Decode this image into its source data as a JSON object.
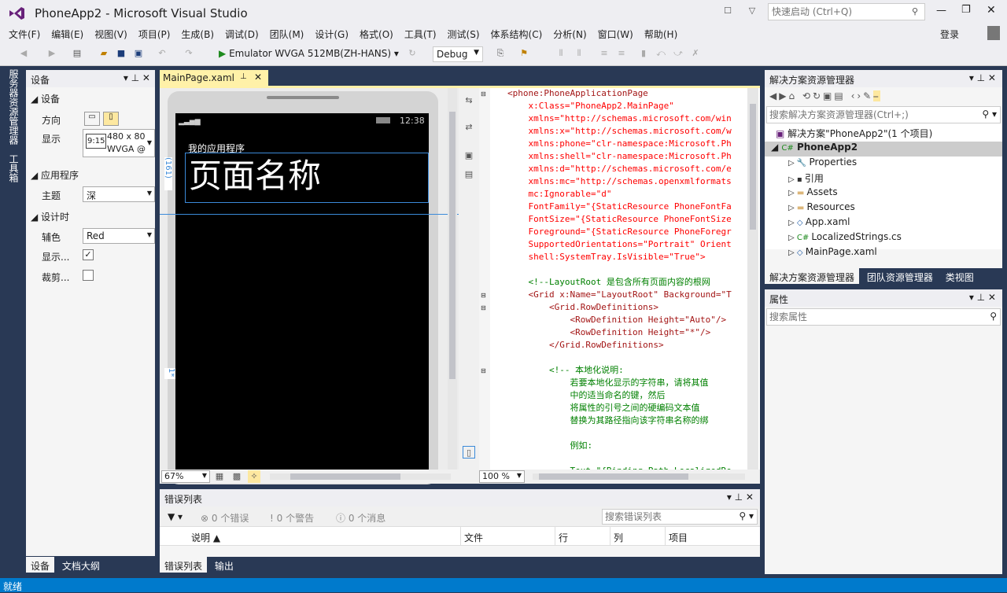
{
  "app": {
    "title": "PhoneApp2 - Microsoft Visual Studio",
    "quick_launch_placeholder": "快速启动 (Ctrl+Q)",
    "signin": "登录"
  },
  "menu": [
    "文件(F)",
    "编辑(E)",
    "视图(V)",
    "项目(P)",
    "生成(B)",
    "调试(D)",
    "团队(M)",
    "设计(G)",
    "格式(O)",
    "工具(T)",
    "测试(S)",
    "体系结构(C)",
    "分析(N)",
    "窗口(W)",
    "帮助(H)"
  ],
  "toolbar": {
    "run_target": "Emulator WVGA 512MB(ZH-HANS)",
    "config": "Debug"
  },
  "left_side_tabs": [
    "服务器资源管理器",
    "工具箱"
  ],
  "device_panel": {
    "title": "设备",
    "section_device": "设备",
    "orientation_label": "方向",
    "display_label": "显示",
    "display_value": "480 x 80",
    "display_value2": "WVGA @",
    "display_icon": "9:15",
    "section_app": "应用程序",
    "theme_label": "主题",
    "theme_value": "深",
    "section_design": "设计时",
    "accent_label": "辅色",
    "accent_value": "Red",
    "show_label": "显示...",
    "clip_label": "裁剪...",
    "tabs": [
      "设备",
      "文档大纲"
    ]
  },
  "editor": {
    "tab": "MainPage.xaml",
    "phone": {
      "time": "12:38",
      "app_title": "我的应用程序",
      "page_title": "页面名称",
      "row_marker1": "(161)",
      "row_marker2": "1*"
    },
    "zoom": "67%",
    "xml_zoom": "100 %",
    "xml_lines": [
      "<phone:PhoneApplicationPage",
      "    x:Class=\"PhoneApp2.MainPage\"",
      "    xmlns=\"http://schemas.microsoft.com/win",
      "    xmlns:x=\"http://schemas.microsoft.com/w",
      "    xmlns:phone=\"clr-namespace:Microsoft.Ph",
      "    xmlns:shell=\"clr-namespace:Microsoft.Ph",
      "    xmlns:d=\"http://schemas.microsoft.com/e",
      "    xmlns:mc=\"http://schemas.openxmlformats",
      "    mc:Ignorable=\"d\"",
      "    FontFamily=\"{StaticResource PhoneFontFa",
      "    FontSize=\"{StaticResource PhoneFontSize",
      "    Foreground=\"{StaticResource PhoneForegr",
      "    SupportedOrientations=\"Portrait\" Orient",
      "    shell:SystemTray.IsVisible=\"True\">",
      "",
      "    <!--LayoutRoot 是包含所有页面内容的根网",
      "    <Grid x:Name=\"LayoutRoot\" Background=\"T",
      "        <Grid.RowDefinitions>",
      "            <RowDefinition Height=\"Auto\"/>",
      "            <RowDefinition Height=\"*\"/>",
      "        </Grid.RowDefinitions>",
      "",
      "        <!-- 本地化说明:",
      "            若要本地化显示的字符串，请将其值",
      "            中的适当命名的键，然后",
      "            将属性的引号之间的硬编码文本值",
      "            替换为其路径指向该字符串名称的绑",
      "",
      "            例如:",
      "",
      "            Text=\"{Binding Path=LocalizedRe"
    ]
  },
  "errors": {
    "title": "错误列表",
    "errors": "0 个错误",
    "warnings": "0 个警告",
    "messages": "0 个消息",
    "search_placeholder": "搜索错误列表",
    "columns": [
      "说明",
      "文件",
      "行",
      "列",
      "项目"
    ],
    "tabs": [
      "错误列表",
      "输出"
    ]
  },
  "solution": {
    "title": "解决方案资源管理器",
    "search_placeholder": "搜索解决方案资源管理器(Ctrl+;)",
    "root": "解决方案\"PhoneApp2\"(1 个项目)",
    "project": "PhoneApp2",
    "items": [
      "Properties",
      "引用",
      "Assets",
      "Resources",
      "App.xaml",
      "LocalizedStrings.cs",
      "MainPage.xaml"
    ],
    "tabs": [
      "解决方案资源管理器",
      "团队资源管理器",
      "类视图"
    ]
  },
  "properties": {
    "title": "属性",
    "search_placeholder": "搜索属性"
  },
  "status": "就绪",
  "colors": {
    "accent": "#007acc",
    "vs_purple": "#68217a",
    "workspace": "#293955"
  }
}
